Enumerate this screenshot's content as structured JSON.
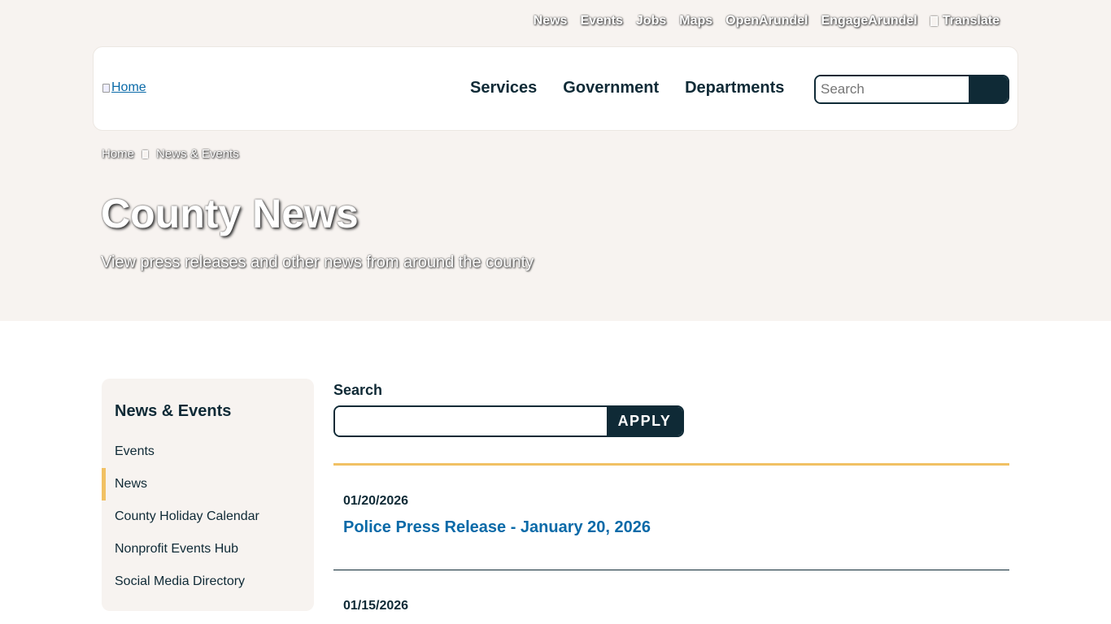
{
  "utility_nav": {
    "items": [
      "News",
      "Events",
      "Jobs",
      "Maps",
      "OpenArundel",
      "EngageArundel"
    ],
    "translate_label": "Translate",
    "translate_icon": "globe-icon"
  },
  "header": {
    "logo_alt": "Home",
    "nav": [
      "Services",
      "Government",
      "Departments"
    ],
    "search_placeholder": "Search",
    "search_button_icon": "search-icon"
  },
  "breadcrumb": {
    "home": "Home",
    "separator_icon": "chevron-right-icon",
    "current": "News & Events"
  },
  "hero": {
    "title": "County News",
    "subtitle": "View press releases and other news from around the county"
  },
  "sidebar": {
    "title": "News & Events",
    "items": [
      {
        "label": "Events",
        "active": false
      },
      {
        "label": "News",
        "active": true
      },
      {
        "label": "County Holiday Calendar",
        "active": false
      },
      {
        "label": "Nonprofit Events Hub",
        "active": false
      },
      {
        "label": "Social Media Directory",
        "active": false
      }
    ]
  },
  "filter": {
    "label": "Search",
    "value": "",
    "apply_label": "APPLY"
  },
  "news": [
    {
      "date": "01/20/2026",
      "title": "Police Press Release - January 20, 2026"
    },
    {
      "date": "01/15/2026",
      "title": ""
    }
  ],
  "colors": {
    "navy": "#0f2a36",
    "link_blue": "#0a6aa8",
    "gold": "#f1c164",
    "hero_bg": "#f7f3f0"
  }
}
